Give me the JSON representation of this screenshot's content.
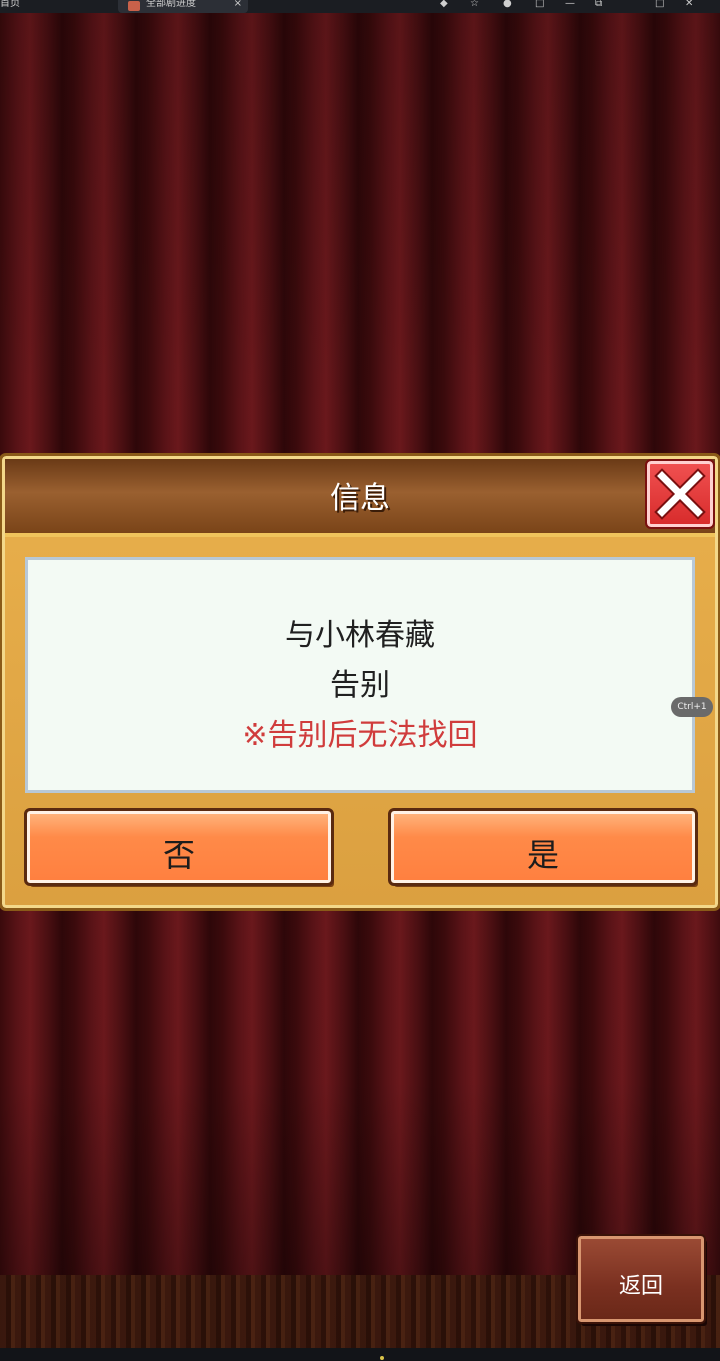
{
  "browser": {
    "home_label": "首页",
    "tab_title": "全部剧进度",
    "tab_close": "×",
    "controls": [
      "□",
      "—",
      "⧉",
      "□",
      "✕"
    ]
  },
  "dialog": {
    "title": "信息",
    "message_line1": "与小林春藏",
    "message_line2": "告别",
    "warning": "※告别后无法找回",
    "no_label": "否",
    "yes_label": "是"
  },
  "badge": "Ctrl+1",
  "back_label": "返回",
  "colors": {
    "curtain": "#4a0f12",
    "dialog_frame": "#e9b04c",
    "header": "#7a4418",
    "button": "#ff8a48",
    "warning_text": "#d03c3c",
    "close": "#e03a3a"
  }
}
